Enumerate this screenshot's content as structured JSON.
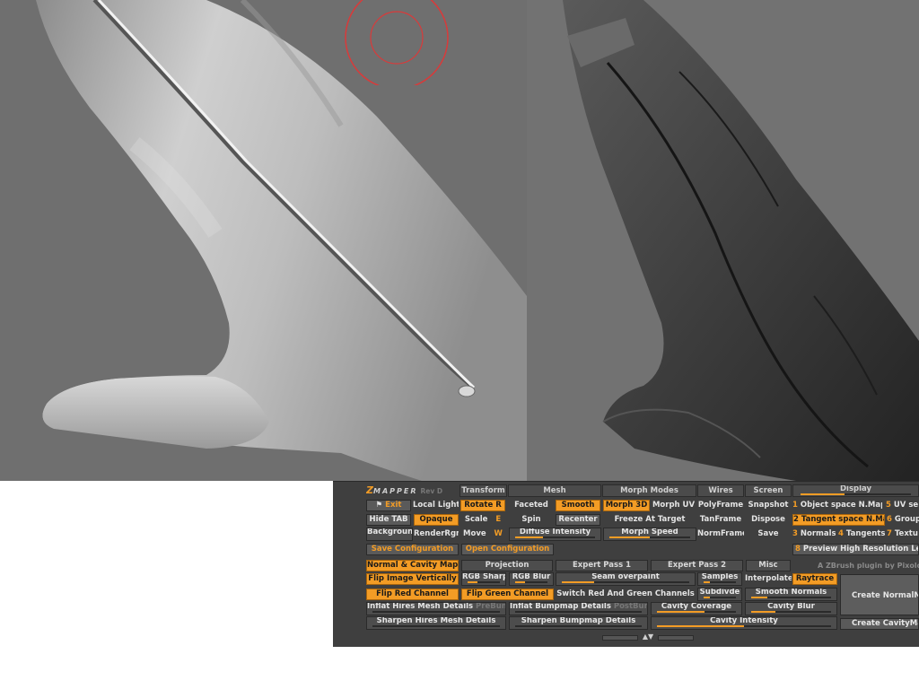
{
  "app": {
    "logo_prefix": "Z",
    "logo_name": "MAPPER",
    "logo_rev": "Rev D"
  },
  "menus": [
    {
      "label": "Transform"
    },
    {
      "label": "Mesh"
    },
    {
      "label": "Morph Modes"
    },
    {
      "label": "Wires"
    },
    {
      "label": "Screen"
    },
    {
      "label": "Display"
    }
  ],
  "buttons": {
    "exit": "Exit",
    "local_light": "Local Light",
    "rotate": "Rotate",
    "rotate_key": "R",
    "faceted": "Faceted",
    "smooth": "Smooth",
    "morph_3d": "Morph 3D",
    "morph_uv": "Morph UV",
    "polyframe": "PolyFrame",
    "snapshot": "Snapshot",
    "hide_tab": "Hide TAB",
    "opaque": "Opaque",
    "scale": "Scale",
    "scale_key": "E",
    "spin": "Spin",
    "recenter": "Recenter",
    "freeze_at_target": "Freeze At Target",
    "tanframe": "TanFrame",
    "dispose": "Dispose",
    "background": "Background",
    "renderrgn": "RenderRgn",
    "move": "Move",
    "move_key": "W",
    "diffuse_intensity": "Diffuse Intensity",
    "morph_speed": "Morph Speed",
    "normframe": "NormFrame",
    "save": "Save",
    "save_configuration": "Save Configuration",
    "open_configuration": "Open Configuration"
  },
  "display_options": [
    {
      "num": "1",
      "label": "Object space N.Map"
    },
    {
      "num": "5",
      "label": "UV se"
    },
    {
      "num": "2",
      "label": "Tangent space N.Map"
    },
    {
      "num": "6",
      "label": "Group"
    },
    {
      "num": "3",
      "label": "Normals"
    },
    {
      "num": "4",
      "label": "Tangents"
    },
    {
      "num": "7",
      "label": "Textu"
    },
    {
      "num": "8",
      "label": "Preview High Resolution Leve"
    }
  ],
  "tabs": [
    {
      "label": "Normal & Cavity Map"
    },
    {
      "label": "Projection"
    },
    {
      "label": "Expert Pass 1"
    },
    {
      "label": "Expert Pass 2"
    },
    {
      "label": "Misc"
    }
  ],
  "credit": "A ZBrush plugin by Pixolog",
  "options": {
    "flip_image_vertically": "Flip Image Vertically",
    "rgb_sharp": "RGB Sharp",
    "rgb_blur": "RGB Blur",
    "seam_overpaint": "Seam overpaint",
    "samples": "Samples",
    "interpolate": "Interpolate",
    "raytrace": "Raytrace",
    "flip_red_channel": "Flip Red Channel",
    "flip_green_channel": "Flip Green Channel",
    "switch_red_green": "Switch Red And Green Channels",
    "subdivide": "Subdivde",
    "smooth_normals": "Smooth Normals",
    "inflat_hires": "Inflat Hires Mesh Details",
    "prebump": "PreBump",
    "inflat_bumpmap": "Inflat Bumpmap Details",
    "postbump": "PostBump",
    "cavity_coverage": "Cavity Coverage",
    "cavity_blur": "Cavity Blur",
    "sharpen_hires": "Sharpen Hires Mesh Details",
    "sharpen_bumpmap": "Sharpen Bumpmap Details",
    "cavity_intensity": "Cavity Intensity",
    "create_normalmap": "Create NormalMa",
    "create_cavitymap": "Create CavityMa"
  },
  "levels": {
    "display": 0.4,
    "diffuse_intensity": 0.35,
    "morph_speed": 0.5,
    "rgb_sharp": 0.3,
    "rgb_blur": 0.3,
    "seam_overpaint": 0.25,
    "samples": 0.2,
    "subdivide": 0.2,
    "smooth_normals": 0.2,
    "cavity_coverage": 0.6,
    "cavity_blur": 0.3,
    "cavity_intensity": 0.5
  },
  "colors": {
    "accent": "#f39c25",
    "panel_bg": "#3f3f3f",
    "brush_circle": "#d93a3a"
  }
}
